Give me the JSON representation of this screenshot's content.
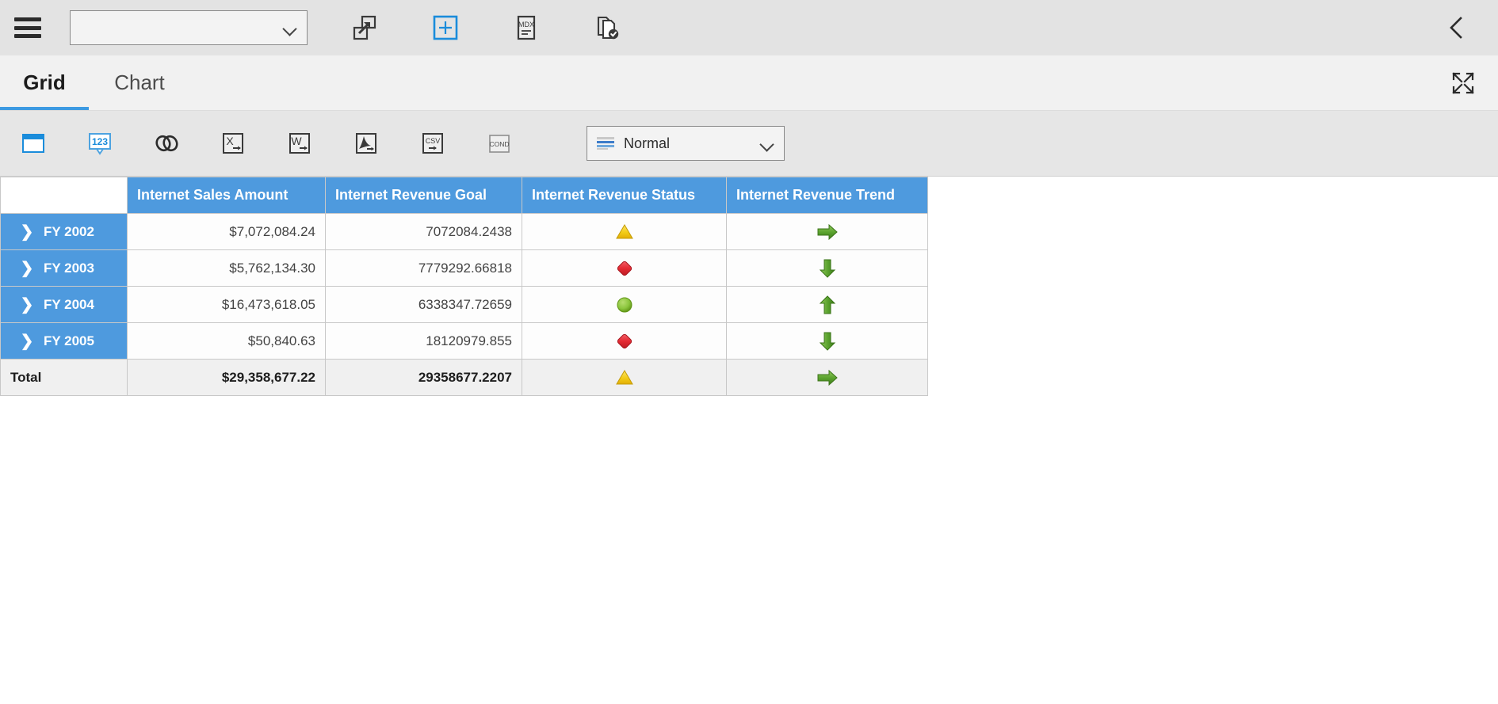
{
  "top_bar": {
    "menu_button": "menu-icon",
    "cube_select": {
      "value": "",
      "placeholder": ""
    },
    "tools": [
      {
        "name": "open-in-new-window-button",
        "icon": "external-window-icon",
        "label": ""
      },
      {
        "name": "add-calculated-member-button",
        "icon": "plus-box-icon",
        "label": ""
      },
      {
        "name": "mdx-query-button",
        "icon": "mdx-document-icon",
        "label": "MDX"
      },
      {
        "name": "validate-copy-button",
        "icon": "document-check-icon",
        "label": ""
      }
    ],
    "collapse_button": {
      "name": "collapse-panel-button",
      "icon": "chevron-left-icon"
    }
  },
  "tabs": {
    "items": [
      {
        "label": "Grid",
        "active": true
      },
      {
        "label": "Chart",
        "active": false
      }
    ],
    "fullscreen_button": {
      "icon": "fullscreen-expand-icon"
    }
  },
  "toolbar": {
    "buttons": [
      {
        "name": "toggle-panel-button",
        "icon": "window-pane-icon",
        "label": ""
      },
      {
        "name": "number-format-button",
        "icon": "123-callout-icon",
        "label": "123"
      },
      {
        "name": "hyperlink-button",
        "icon": "link-chain-icon",
        "label": ""
      },
      {
        "name": "export-excel-button",
        "icon": "excel-export-icon",
        "label": "X"
      },
      {
        "name": "export-word-button",
        "icon": "word-export-icon",
        "label": "W"
      },
      {
        "name": "export-pdf-button",
        "icon": "pdf-export-icon",
        "label": ""
      },
      {
        "name": "export-csv-button",
        "icon": "csv-export-icon",
        "label": "CSV"
      },
      {
        "name": "conditional-format-button",
        "icon": "conditional-format-icon",
        "label": "COND"
      }
    ],
    "format_select": {
      "value": "Normal",
      "icon": "format-stripes-icon"
    }
  },
  "grid": {
    "corner_label": "",
    "columns": [
      "Internet Sales Amount",
      "Internet Revenue Goal",
      "Internet Revenue Status",
      "Internet Revenue Trend"
    ],
    "rows": [
      {
        "header": "FY 2002",
        "expander": "chevron-right-icon",
        "sales": "$7,072,084.24",
        "goal": "7072084.2438",
        "status": "warning-triangle",
        "trend": "arrow-right"
      },
      {
        "header": "FY 2003",
        "expander": "chevron-right-icon",
        "sales": "$5,762,134.30",
        "goal": "7779292.66818",
        "status": "danger-diamond",
        "trend": "arrow-down"
      },
      {
        "header": "FY 2004",
        "expander": "chevron-right-icon",
        "sales": "$16,473,618.05",
        "goal": "6338347.72659",
        "status": "ok-circle",
        "trend": "arrow-up"
      },
      {
        "header": "FY 2005",
        "expander": "chevron-right-icon",
        "sales": "$50,840.63",
        "goal": "18120979.855",
        "status": "danger-diamond",
        "trend": "arrow-down"
      }
    ],
    "total": {
      "header": "Total",
      "sales": "$29,358,677.22",
      "goal": "29358677.2207",
      "status": "warning-triangle",
      "trend": "arrow-right"
    }
  },
  "colors": {
    "header_blue": "#4e9ade",
    "accent_blue": "#3d9ae2",
    "top_bar_bg": "#e3e3e3",
    "tab_bar_bg": "#f1f1f1",
    "toolbar_bg": "#e6e6e6",
    "status_ok": "#8cc63e",
    "status_warning": "#f2cb1d",
    "status_danger": "#e8333a",
    "trend_green": "#5aa02c"
  }
}
